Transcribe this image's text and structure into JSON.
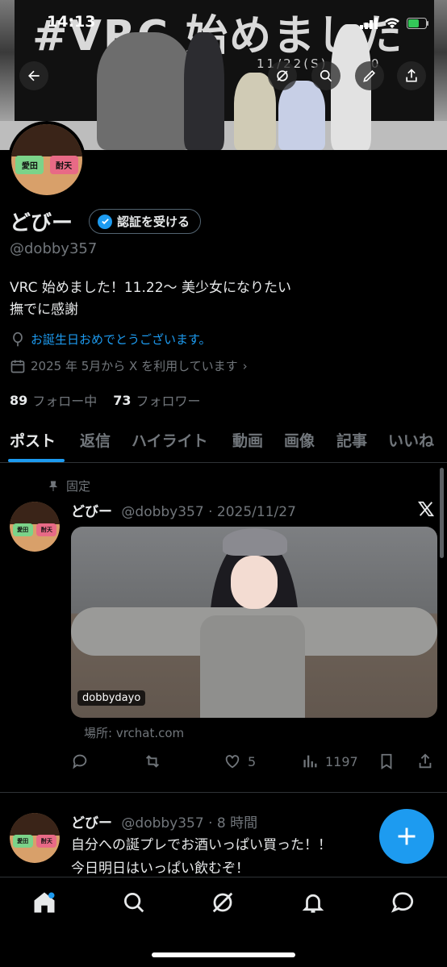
{
  "status_bar": {
    "time": "14:13"
  },
  "banner": {
    "headline": "#VRC 始めました",
    "date_text": "11/22(S) 18:20"
  },
  "profile": {
    "display_name": "どびー",
    "verify_label": "認証を受ける",
    "handle": "@dobby357",
    "bio_line1": "VRC 始めました！11.22〜 美少女になりたい",
    "bio_line2": "撫でに感謝",
    "birthday": "お誕生日おめでとうございます。",
    "joined": "2025 年 5月から X を利用しています",
    "following_count": "89",
    "following_label": "フォロー中",
    "followers_count": "73",
    "followers_label": "フォロワー"
  },
  "tabs": [
    "ポスト",
    "返信",
    "ハイライト",
    "動画",
    "画像",
    "記事",
    "いいね"
  ],
  "avatar_glasses": {
    "left": "愛田",
    "right": "酎天"
  },
  "posts": [
    {
      "pinned_label": "固定",
      "author": "どびー",
      "meta": "@dobby357 · 2025/11/27",
      "media_tag": "dobbydayo",
      "location": "場所: vrchat.com",
      "likes": "5",
      "views": "1197"
    },
    {
      "author": "どびー",
      "meta": "@dobby357 · 8 時間",
      "text_line1": "自分への誕プレでお酒いっぱい買った！！",
      "text_line2": "今日明日はいっぱい飲むぞ！"
    }
  ],
  "colors": {
    "accent": "#1d9bf0",
    "background": "#000000",
    "muted": "#71767b"
  },
  "icons": [
    "back-icon",
    "grok-icon",
    "search-icon",
    "edit-icon",
    "share-icon",
    "verified-badge-icon",
    "balloon-icon",
    "calendar-icon",
    "pin-icon",
    "x-logo-icon",
    "reply-icon",
    "repost-icon",
    "like-icon",
    "views-icon",
    "bookmark-icon",
    "plus-icon",
    "home-icon",
    "notifications-icon",
    "messages-icon"
  ]
}
